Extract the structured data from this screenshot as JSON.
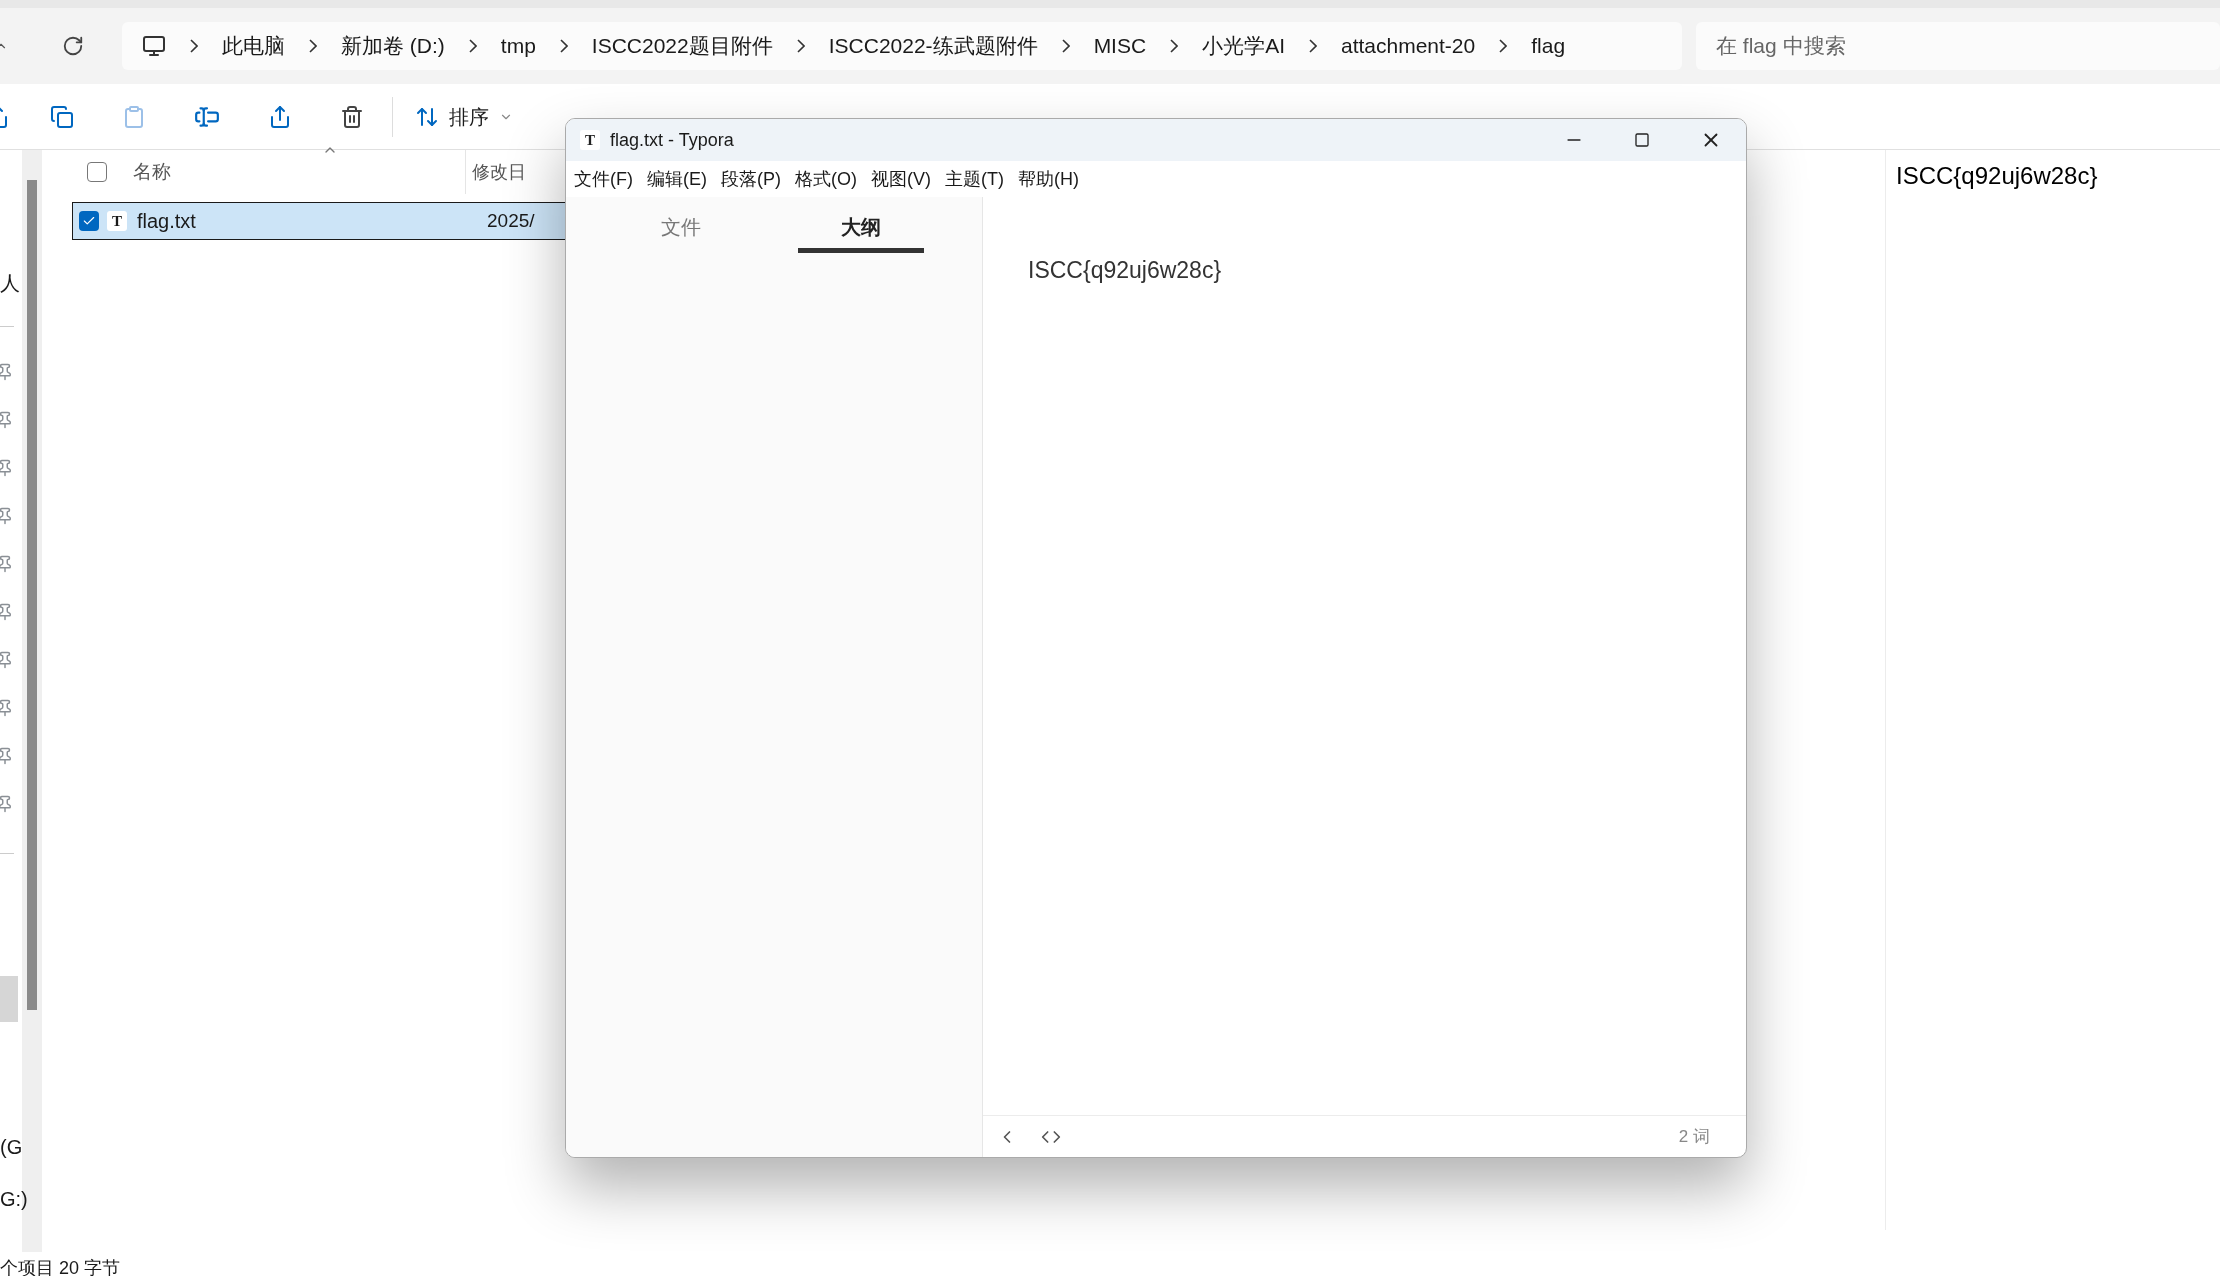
{
  "explorer": {
    "breadcrumb": [
      "此电脑",
      "新加卷 (D:)",
      "tmp",
      "ISCC2022题目附件",
      "ISCC2022-练武题附件",
      "MISC",
      "小光学AI",
      "attachment-20",
      "flag"
    ],
    "search": {
      "placeholder": "在 flag 中搜索"
    },
    "toolbar": {
      "sort": "排序"
    },
    "select_all": {
      "checked": false
    },
    "nav_items": [
      {
        "label": "人"
      },
      {
        "label": "(G"
      },
      {
        "label": "G:)"
      }
    ],
    "columns": [
      "名称",
      "修改日"
    ],
    "files": [
      {
        "icon": "T",
        "name": "flag.txt",
        "modified": "2025/",
        "selected": true,
        "checked": true
      }
    ],
    "preview": "ISCC{q92uj6w28c}",
    "status": "个项目  20 字节"
  },
  "typora": {
    "icon": "T",
    "title": "flag.txt - Typora",
    "menu": [
      "文件(F)",
      "编辑(E)",
      "段落(P)",
      "格式(O)",
      "视图(V)",
      "主题(T)",
      "帮助(H)"
    ],
    "tabs": [
      {
        "label": "文件",
        "selected": false
      },
      {
        "label": "大纲",
        "selected": true
      }
    ],
    "content": "ISCC{q92uj6w28c}",
    "word_count": "2 词"
  }
}
